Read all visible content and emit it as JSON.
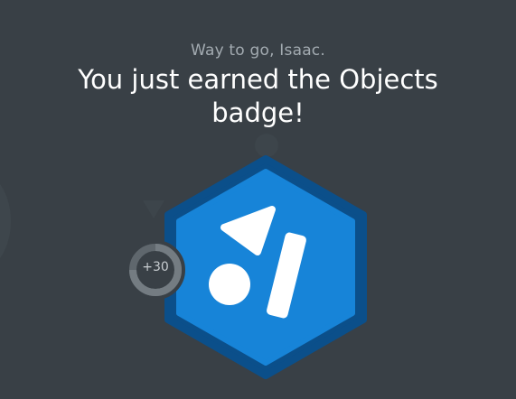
{
  "greeting": "Way to go, Isaac.",
  "headline": "You just earned the Objects badge!",
  "badge": {
    "icon": "objects-badge-icon"
  },
  "points": {
    "label": "+30"
  },
  "colors": {
    "background": "#394046",
    "badge_outer": "#0b4f8a",
    "badge_inner": "#1784d8",
    "badge_shapes": "#ffffff",
    "ring": "#5f676d",
    "ring_fill": "#747c82"
  }
}
